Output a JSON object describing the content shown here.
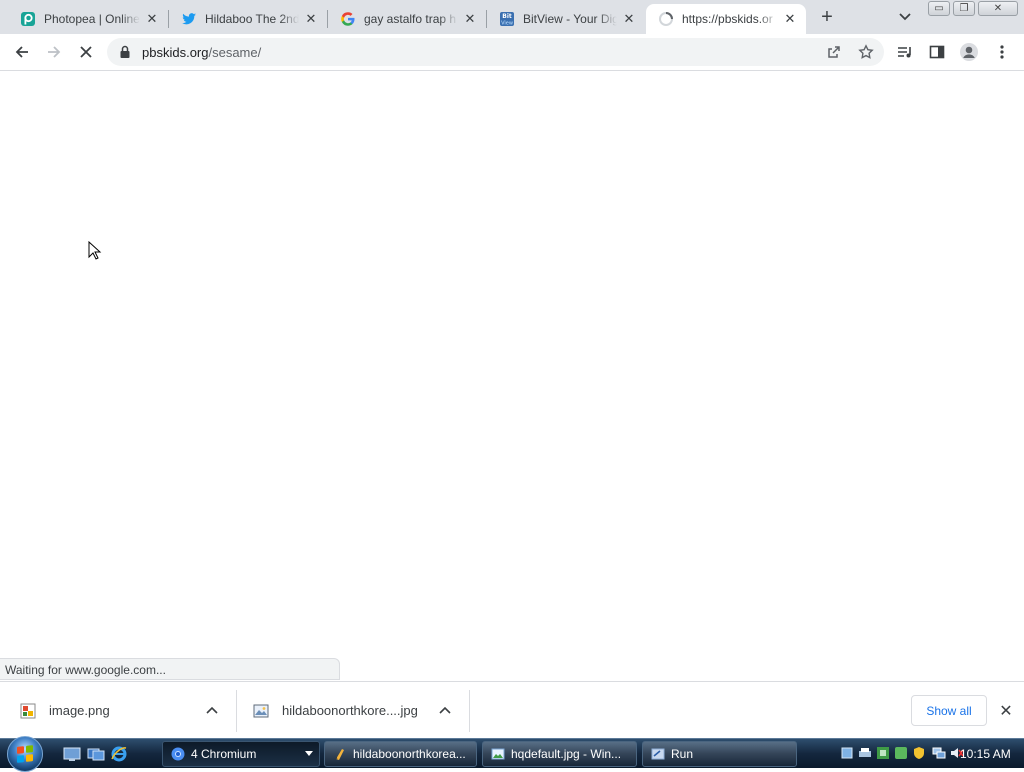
{
  "browser": {
    "tabs": [
      {
        "title": "Photopea | Online",
        "icon": "photopea-icon",
        "color": "#18a497"
      },
      {
        "title": "Hildaboo The 2nd",
        "icon": "twitter-icon",
        "color": "#1d9bf0"
      },
      {
        "title": "gay astalfo trap h",
        "icon": "google-icon"
      },
      {
        "title": "BitView - Your Dig",
        "icon": "bitview-icon",
        "color": "#3a6fb0"
      },
      {
        "title": "https://pbskids.or",
        "icon": "loading-spinner-icon",
        "active": true
      }
    ],
    "new_tab_symbol": "+",
    "tab_close_symbol": "✕",
    "window_controls": {
      "minimize": "▭",
      "restore": "❐",
      "close": "✕"
    }
  },
  "toolbar": {
    "url_host": "pbskids.org",
    "url_path": "/sesame/",
    "state": "loading"
  },
  "status": {
    "text": "Waiting for www.google.com..."
  },
  "downloads": {
    "items": [
      {
        "name": "image.png",
        "icon": "png-file-icon"
      },
      {
        "name": "hildaboonorthkore....jpg",
        "icon": "jpg-file-icon"
      }
    ],
    "show_all_label": "Show all",
    "close_symbol": "✕"
  },
  "taskbar": {
    "buttons": [
      {
        "label": "4 Chromium",
        "icon": "chromium-icon",
        "active": true
      },
      {
        "label": "hildaboonorthkorea...",
        "icon": "paint-icon"
      },
      {
        "label": "hqdefault.jpg - Win...",
        "icon": "photo-viewer-icon"
      },
      {
        "label": "Run",
        "icon": "run-icon"
      }
    ],
    "clock": "10:15 AM"
  },
  "colors": {
    "accent": "#1a73e8",
    "tabstrip": "#dee1e6"
  }
}
